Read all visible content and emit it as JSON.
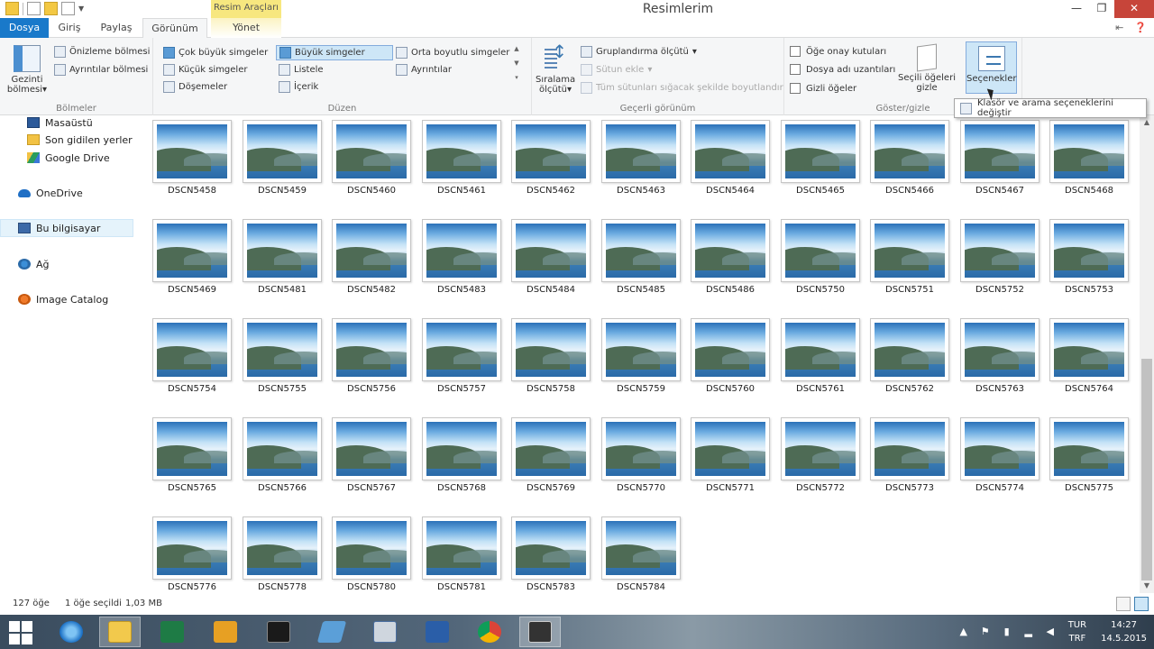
{
  "window": {
    "title": "Resimlerim",
    "context_tab_header": "Resim Araçları"
  },
  "tabs": [
    {
      "label": "Dosya"
    },
    {
      "label": "Giriş"
    },
    {
      "label": "Paylaş"
    },
    {
      "label": "Görünüm"
    },
    {
      "label": "Yönet"
    }
  ],
  "ribbon": {
    "panes": {
      "nav_pane_label_1": "Gezinti",
      "nav_pane_label_2": "bölmesi",
      "preview_pane": "Önizleme bölmesi",
      "details_pane": "Ayrıntılar bölmesi",
      "group_label": "Bölmeler"
    },
    "layout": {
      "items": [
        "Çok büyük simgeler",
        "Büyük simgeler",
        "Orta boyutlu simgeler",
        "Küçük simgeler",
        "Listele",
        "Ayrıntılar",
        "Döşemeler",
        "İçerik"
      ],
      "selected": "Büyük simgeler",
      "group_label": "Düzen"
    },
    "current_view": {
      "sort_by_1": "Sıralama",
      "sort_by_2": "ölçütü",
      "group_by": "Gruplandırma ölçütü",
      "add_columns": "Sütun ekle",
      "fit_columns": "Tüm sütunları sığacak şekilde boyutlandır",
      "group_label": "Geçerli görünüm"
    },
    "show_hide": {
      "item_checkboxes": "Öğe onay kutuları",
      "file_extensions": "Dosya adı uzantıları",
      "hidden_items": "Gizli öğeler",
      "hide_selected_1": "Seçili öğeleri",
      "hide_selected_2": "gizle",
      "options": "Seçenekler",
      "group_label": "Göster/gizle"
    },
    "tooltip": "Klasör ve arama seçeneklerini değiştir"
  },
  "nav": {
    "items": [
      {
        "label": "Masaüstü",
        "icon": "desktop-icon"
      },
      {
        "label": "Son gidilen yerler",
        "icon": "recent-places-icon"
      },
      {
        "label": "Google Drive",
        "icon": "google-drive-icon"
      },
      {
        "label": "OneDrive",
        "icon": "onedrive-icon"
      },
      {
        "label": "Bu bilgisayar",
        "icon": "this-pc-icon"
      },
      {
        "label": "Ağ",
        "icon": "network-icon"
      },
      {
        "label": "Image Catalog",
        "icon": "image-catalog-icon"
      }
    ],
    "selected": "Bu bilgisayar"
  },
  "files": [
    "DSCN5458",
    "DSCN5459",
    "DSCN5460",
    "DSCN5461",
    "DSCN5462",
    "DSCN5463",
    "DSCN5464",
    "DSCN5465",
    "DSCN5466",
    "DSCN5467",
    "DSCN5468",
    "DSCN5469",
    "DSCN5481",
    "DSCN5482",
    "DSCN5483",
    "DSCN5484",
    "DSCN5485",
    "DSCN5486",
    "DSCN5750",
    "DSCN5751",
    "DSCN5752",
    "DSCN5753",
    "DSCN5754",
    "DSCN5755",
    "DSCN5756",
    "DSCN5757",
    "DSCN5758",
    "DSCN5759",
    "DSCN5760",
    "DSCN5761",
    "DSCN5762",
    "DSCN5763",
    "DSCN5764",
    "DSCN5765",
    "DSCN5766",
    "DSCN5767",
    "DSCN5768",
    "DSCN5769",
    "DSCN5770",
    "DSCN5771",
    "DSCN5772",
    "DSCN5773",
    "DSCN5774",
    "DSCN5775",
    "DSCN5776",
    "DSCN5778",
    "DSCN5780",
    "DSCN5781",
    "DSCN5783",
    "DSCN5784"
  ],
  "status": {
    "item_count": "127 öğe",
    "selection": "1 öğe seçildi",
    "size": "1,03 MB"
  },
  "taskbar": {
    "apps": [
      "internet-explorer-icon",
      "file-explorer-icon",
      "excel-icon",
      "outlook-icon",
      "command-prompt-icon",
      "folder-icon",
      "remote-desktop-icon",
      "network-app-icon",
      "chrome-icon",
      "app-icon"
    ],
    "active": "file-explorer-icon",
    "lang_1": "TUR",
    "lang_2": "TRF",
    "time": "14:27",
    "date": "14.5.2015"
  },
  "colors": {
    "accent": "#1979ca",
    "selection": "#cde6f7",
    "context_tab": "#f7e77f",
    "close_button": "#c7453a"
  }
}
